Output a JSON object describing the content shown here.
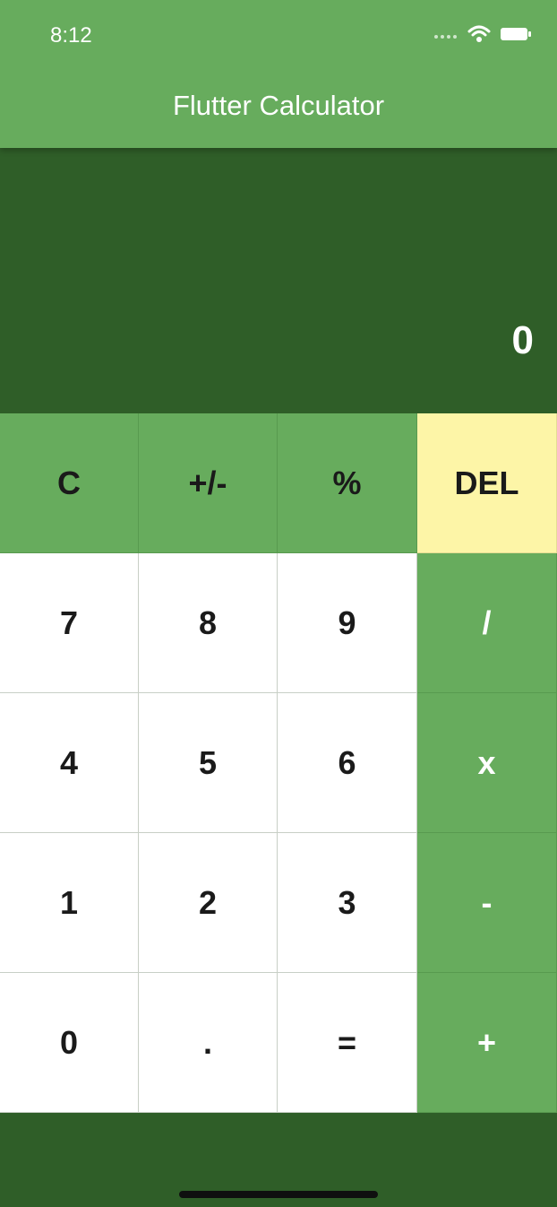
{
  "status_bar": {
    "time": "8:12",
    "icons": [
      "cellular-dots-icon",
      "wifi-icon",
      "battery-icon"
    ]
  },
  "app": {
    "title": "Flutter Calculator"
  },
  "display": {
    "value": "0"
  },
  "keypad": {
    "rows": [
      [
        {
          "label": "C",
          "kind": "fn"
        },
        {
          "label": "+/-",
          "kind": "fn"
        },
        {
          "label": "%",
          "kind": "fn"
        },
        {
          "label": "DEL",
          "kind": "del"
        }
      ],
      [
        {
          "label": "7",
          "kind": "num"
        },
        {
          "label": "8",
          "kind": "num"
        },
        {
          "label": "9",
          "kind": "num"
        },
        {
          "label": "/",
          "kind": "op"
        }
      ],
      [
        {
          "label": "4",
          "kind": "num"
        },
        {
          "label": "5",
          "kind": "num"
        },
        {
          "label": "6",
          "kind": "num"
        },
        {
          "label": "x",
          "kind": "op"
        }
      ],
      [
        {
          "label": "1",
          "kind": "num"
        },
        {
          "label": "2",
          "kind": "num"
        },
        {
          "label": "3",
          "kind": "num"
        },
        {
          "label": "-",
          "kind": "op"
        }
      ],
      [
        {
          "label": "0",
          "kind": "num"
        },
        {
          "label": ".",
          "kind": "num"
        },
        {
          "label": "=",
          "kind": "num"
        },
        {
          "label": "+",
          "kind": "op"
        }
      ]
    ]
  },
  "colors": {
    "app_bar": "#67ac5d",
    "display_bg": "#2f5e28",
    "number_key": "#ffffff",
    "function_key": "#67ac5d",
    "delete_key": "#fdf5a7",
    "operator_key": "#67ac5d"
  }
}
